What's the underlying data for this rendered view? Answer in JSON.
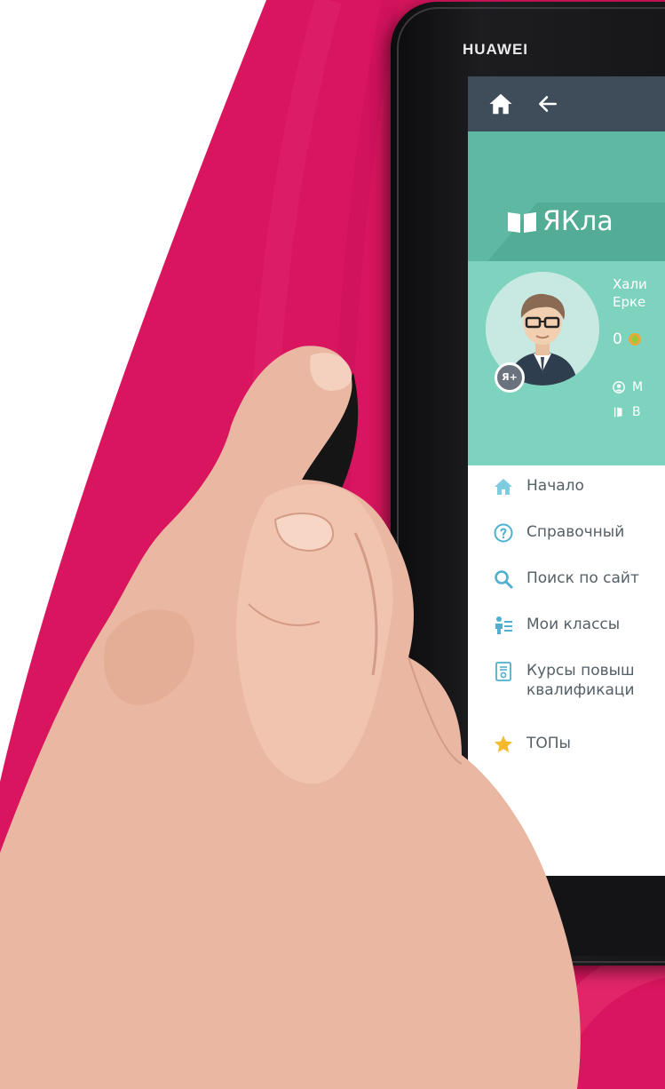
{
  "colors": {
    "background_magenta": "#d8155e",
    "topbar": "#3f4c5a",
    "logo_band": "#5fb8a2",
    "profile_band": "#7ed3bf",
    "menu_text": "#555f66"
  },
  "device": {
    "brand": "HUAWEI"
  },
  "app": {
    "topbar": {
      "home_icon": "home-icon",
      "back_icon": "arrow-left-icon"
    },
    "logo": {
      "icon": "open-book-icon",
      "text": "ЯКла"
    },
    "profile": {
      "avatar_badge": "Я+",
      "name_line1": "Хали",
      "name_line2": "Ерке",
      "points": "0",
      "link1": "М",
      "link2": "В"
    },
    "menu": [
      {
        "icon": "home-icon",
        "label": "Начало"
      },
      {
        "icon": "question-circle-icon",
        "label": "Справочный"
      },
      {
        "icon": "search-icon",
        "label": "Поиск по сайт"
      },
      {
        "icon": "classes-icon",
        "label": "Мои классы"
      },
      {
        "icon": "certificate-icon",
        "label": "Курсы повыш",
        "label2": "квалификаци"
      },
      {
        "icon": "star-icon",
        "label": "ТОПы"
      }
    ]
  }
}
